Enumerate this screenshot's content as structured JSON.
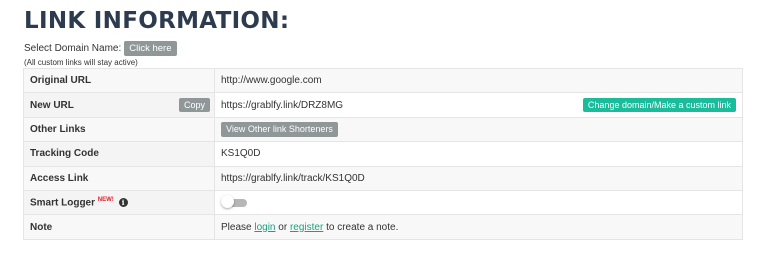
{
  "page_title": "LINK INFORMATION:",
  "domain": {
    "label": "Select Domain Name:",
    "button": "Click here",
    "note": "(All custom links will stay active)"
  },
  "rows": {
    "original_url": {
      "label": "Original URL",
      "value": "http://www.google.com"
    },
    "new_url": {
      "label": "New URL",
      "value": "https://grablfy.link/DRZ8MG",
      "copy": "Copy",
      "change": "Change domain/Make a custom link"
    },
    "other_links": {
      "label": "Other Links",
      "button": "View Other link Shorteners"
    },
    "tracking_code": {
      "label": "Tracking Code",
      "value": "KS1Q0D"
    },
    "access_link": {
      "label": "Access Link",
      "value": "https://grablfy.link/track/KS1Q0D"
    },
    "smart_logger": {
      "label": "Smart Logger",
      "badge": "NEW!",
      "info_icon": "i",
      "toggle_on": false
    },
    "note": {
      "label": "Note",
      "prefix": "Please ",
      "login": "login",
      "or": " or ",
      "register": "register",
      "suffix": " to create a note."
    }
  },
  "colors": {
    "title": "#2d3b4e",
    "teal": "#1abc9c",
    "grey_button": "#8f9799",
    "badge_red": "#e0242b"
  }
}
